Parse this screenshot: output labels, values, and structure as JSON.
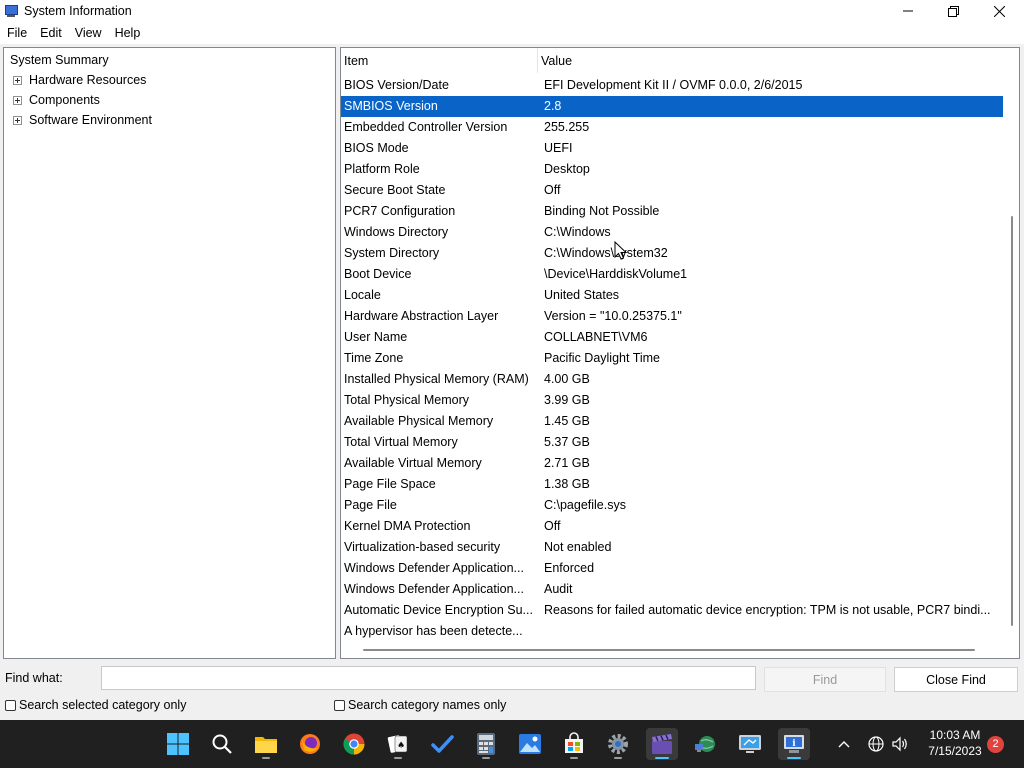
{
  "window": {
    "title": "System Information"
  },
  "menu": {
    "items": [
      "File",
      "Edit",
      "View",
      "Help"
    ]
  },
  "tree": {
    "root": "System Summary",
    "children": [
      "Hardware Resources",
      "Components",
      "Software Environment"
    ]
  },
  "list": {
    "columns": {
      "item": "Item",
      "value": "Value"
    },
    "selected_index": 1,
    "rows": [
      {
        "item": "BIOS Version/Date",
        "value": "EFI Development Kit II / OVMF 0.0.0, 2/6/2015"
      },
      {
        "item": "SMBIOS Version",
        "value": "2.8"
      },
      {
        "item": "Embedded Controller Version",
        "value": "255.255"
      },
      {
        "item": "BIOS Mode",
        "value": "UEFI"
      },
      {
        "item": "Platform Role",
        "value": "Desktop"
      },
      {
        "item": "Secure Boot State",
        "value": "Off"
      },
      {
        "item": "PCR7 Configuration",
        "value": "Binding Not Possible"
      },
      {
        "item": "Windows Directory",
        "value": "C:\\Windows"
      },
      {
        "item": "System Directory",
        "value": "C:\\Windows\\system32"
      },
      {
        "item": "Boot Device",
        "value": "\\Device\\HarddiskVolume1"
      },
      {
        "item": "Locale",
        "value": "United States"
      },
      {
        "item": "Hardware Abstraction Layer",
        "value": "Version = \"10.0.25375.1\""
      },
      {
        "item": "User Name",
        "value": "COLLABNET\\VM6"
      },
      {
        "item": "Time Zone",
        "value": "Pacific Daylight Time"
      },
      {
        "item": "Installed Physical Memory (RAM)",
        "value": "4.00 GB"
      },
      {
        "item": "Total Physical Memory",
        "value": "3.99 GB"
      },
      {
        "item": "Available Physical Memory",
        "value": "1.45 GB"
      },
      {
        "item": "Total Virtual Memory",
        "value": "5.37 GB"
      },
      {
        "item": "Available Virtual Memory",
        "value": "2.71 GB"
      },
      {
        "item": "Page File Space",
        "value": "1.38 GB"
      },
      {
        "item": "Page File",
        "value": "C:\\pagefile.sys"
      },
      {
        "item": "Kernel DMA Protection",
        "value": "Off"
      },
      {
        "item": "Virtualization-based security",
        "value": "Not enabled"
      },
      {
        "item": "Windows Defender Application...",
        "value": "Enforced"
      },
      {
        "item": "Windows Defender Application...",
        "value": "Audit"
      },
      {
        "item": "Automatic Device Encryption Su...",
        "value": "Reasons for failed automatic device encryption: TPM is not usable, PCR7 bindi..."
      },
      {
        "item": "A hypervisor has been detecte...",
        "value": ""
      }
    ]
  },
  "find": {
    "label": "Find what:",
    "value": "",
    "find_button": "Find",
    "close_button": "Close Find",
    "checkbox_selected_category": "Search selected category only",
    "checkbox_category_names": "Search category names only"
  },
  "taskbar": {
    "icons": [
      "start-icon",
      "search-icon",
      "file-explorer-icon",
      "firefox-icon",
      "chrome-icon",
      "solitaire-icon",
      "todo-icon",
      "calculator-icon",
      "photos-icon",
      "store-icon",
      "settings-icon",
      "clapper-icon",
      "network-globe-icon",
      "remote-desktop-icon",
      "system-information-icon"
    ],
    "time": "10:03 AM",
    "date": "7/15/2023",
    "notification_count": "2"
  },
  "colors": {
    "selection": "#0a64c8",
    "taskbar": "#202020",
    "accent": "#4cc2ff"
  }
}
